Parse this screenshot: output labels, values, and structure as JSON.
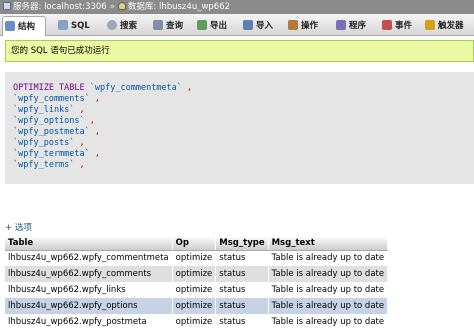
{
  "breadcrumb": {
    "server": "服务器: localhost:3306",
    "separator": "»",
    "database": "数据库: lhbusz4u_wp662"
  },
  "tabs": [
    {
      "label": "结构",
      "icon": "structure-icon"
    },
    {
      "label": "SQL",
      "icon": "sql-icon"
    },
    {
      "label": "搜索",
      "icon": "search-icon"
    },
    {
      "label": "查询",
      "icon": "query-icon"
    },
    {
      "label": "导出",
      "icon": "export-icon"
    },
    {
      "label": "导入",
      "icon": "import-icon"
    },
    {
      "label": "操作",
      "icon": "operations-icon"
    },
    {
      "label": "程序",
      "icon": "routines-icon"
    },
    {
      "label": "事件",
      "icon": "events-icon"
    },
    {
      "label": "触发器",
      "icon": "triggers-icon"
    }
  ],
  "message": "您的 SQL 语句已成功运行",
  "sql": {
    "keyword": "OPTIMIZE TABLE",
    "tables": [
      "`wpfy_commentmeta`",
      "`wpfy_comments`",
      "`wpfy_links`",
      "`wpfy_options`",
      "`wpfy_postmeta`",
      "`wpfy_posts`",
      "`wpfy_termmeta`",
      "`wpfy_terms`"
    ],
    "comma": ","
  },
  "options_link": "+ 选项",
  "result": {
    "headers": [
      "Table",
      "Op",
      "Msg_type",
      "Msg_text"
    ],
    "rows": [
      [
        "lhbusz4u_wp662.wpfy_commentmeta",
        "optimize",
        "status",
        "Table is already up to date"
      ],
      [
        "lhbusz4u_wp662.wpfy_comments",
        "optimize",
        "status",
        "Table is already up to date"
      ],
      [
        "lhbusz4u_wp662.wpfy_links",
        "optimize",
        "status",
        "Table is already up to date"
      ],
      [
        "lhbusz4u_wp662.wpfy_options",
        "optimize",
        "status",
        "Table is already up to date"
      ],
      [
        "lhbusz4u_wp662.wpfy_postmeta",
        "optimize",
        "status",
        "Table is already up to date"
      ]
    ]
  },
  "colors": {
    "message_bg": "#ebf8a4",
    "message_border": "#a2d246",
    "sql_keyword": "#770088",
    "sql_table": "#0055aa",
    "row_highlight": "#c6d3e6"
  }
}
